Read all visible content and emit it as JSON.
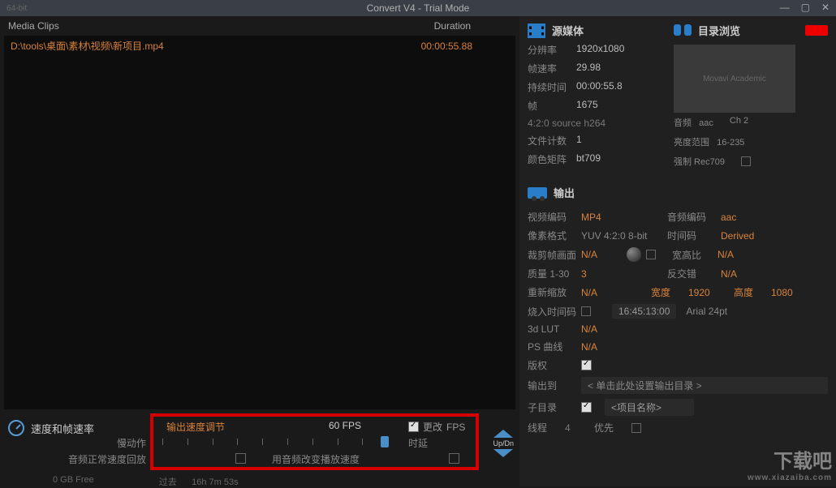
{
  "titlebar": {
    "bitdepth": "64-bit",
    "title": "Convert V4 - Trial Mode"
  },
  "clips": {
    "header_media": "Media Clips",
    "header_duration": "Duration",
    "row": {
      "path": "D:\\tools\\桌面\\素材\\视频\\新项目.mp4",
      "duration": "00:00:55.88"
    }
  },
  "speed": {
    "title": "速度和帧速率",
    "output_speed": "输出速度调节",
    "fps": "60 FPS",
    "change_label": "更改",
    "fps_label": "FPS",
    "slow_label": "慢动作",
    "delay_label": "时延",
    "normal_label": "音频正常速度回放",
    "audio_speed_label": "用音频改变播放速度",
    "updn": "Up/Dn"
  },
  "status": {
    "free": "0 GB Free",
    "past": "过去",
    "elapsed": "16h 7m 53s"
  },
  "source": {
    "title": "源媒体",
    "browse_title": "目录浏览",
    "res_label": "分辨率",
    "res_value": "1920x1080",
    "fps_label": "帧速率",
    "fps_value": "29.98",
    "dur_label": "持续时间",
    "dur_value": "00:00:55.8",
    "frames_label": "帧",
    "frames_value": "1675",
    "format": "4:2:0 source  h264",
    "files_label": "文件计数",
    "files_value": "1",
    "matrix_label": "颜色矩阵",
    "matrix_value": "bt709",
    "audio_label": "音频",
    "audio_value": "aac",
    "ch_value": "Ch 2",
    "luma_label": "亮度范围",
    "luma_value": "16-235",
    "force_label": "强制 Rec709",
    "thumb_text": "Movavi Academic"
  },
  "output": {
    "title": "输出",
    "vcodec_label": "视频编码",
    "vcodec_value": "MP4",
    "acodec_label": "音频编码",
    "acodec_value": "aac",
    "pixfmt_label": "像素格式",
    "pixfmt_value": "YUV 4:2:0 8-bit",
    "timecode_label": "时间码",
    "timecode_value": "Derived",
    "crop_label": "裁剪帧画面",
    "crop_value": "N/A",
    "aspect_label": "宽高比",
    "aspect_value": "N/A",
    "quality_label": "质量 1-30",
    "quality_value": "3",
    "deinterlace_label": "反交错",
    "deinterlace_value": "N/A",
    "rescale_label": "重新缩放",
    "rescale_value": "N/A",
    "width_label": "宽度",
    "width_value": "1920",
    "height_label": "高度",
    "height_value": "1080",
    "burntc_label": "烧入时间码",
    "tc_value": "16:45:13:00",
    "font_value": "Arial 24pt",
    "lut_label": "3d LUT",
    "lut_value": "N/A",
    "ps_label": "PS 曲线",
    "ps_value": "N/A",
    "copyright_label": "版权",
    "outto_label": "输出到",
    "outto_value": "< 单击此处设置输出目录 >",
    "subdir_label": "子目录",
    "subdir_value": "<项目名称>",
    "threads_label": "线程",
    "threads_value": "4",
    "priority_label": "优先"
  },
  "watermark": {
    "large": "下载吧",
    "small": "www.xiazaiba.com"
  }
}
